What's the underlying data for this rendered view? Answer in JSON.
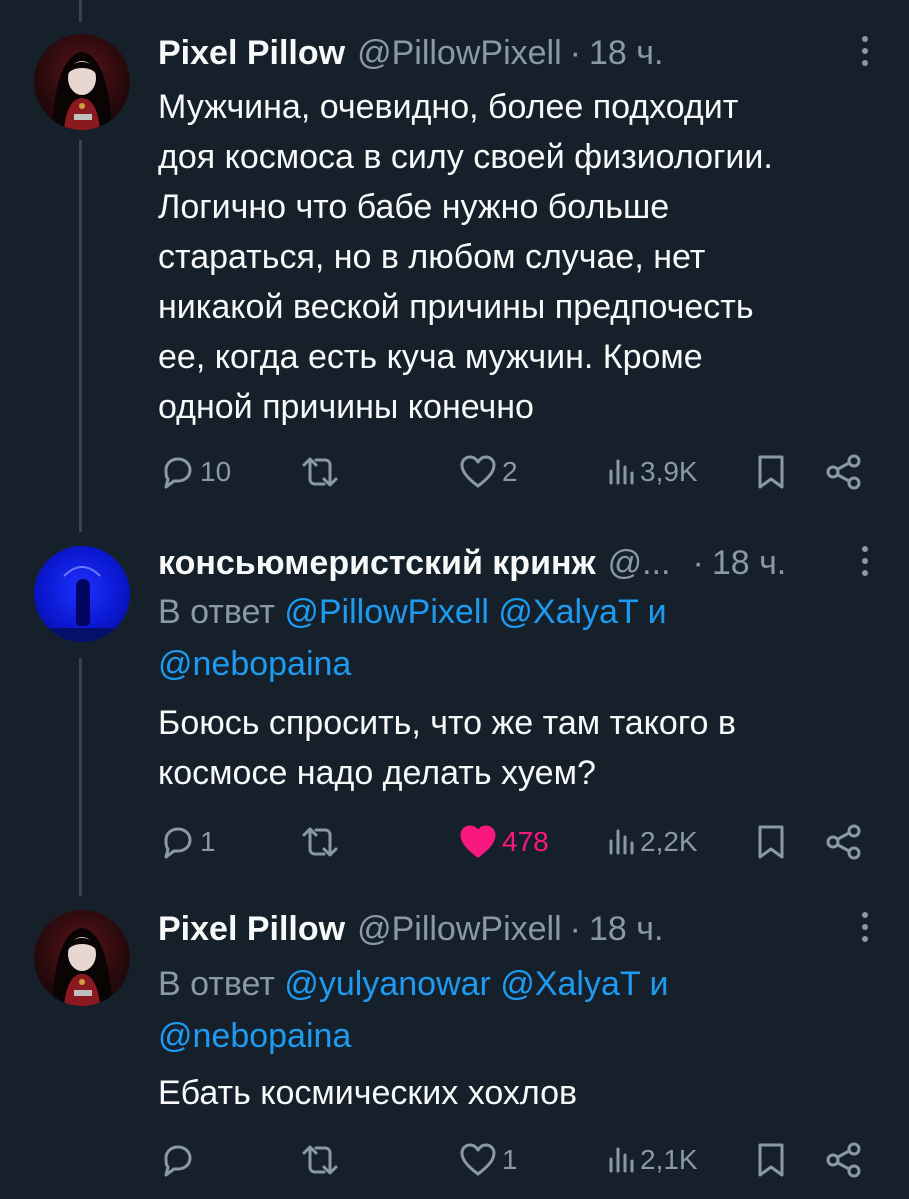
{
  "tweets": [
    {
      "name": "Pixel Pillow",
      "handle": "@PillowPixell",
      "time": "18 ч.",
      "text_lines": [
        "Мужчина, очевидно, более подходит",
        "доя космоса в силу своей физиологии.",
        "Логично что бабе нужно больше",
        "стараться, но в любом случае, нет",
        "никакой веской причины предпочесть",
        "ее, когда есть куча мужчин. Кроме",
        "одной причины конечно"
      ],
      "replies": "10",
      "retweets": "",
      "likes": "2",
      "views": "3,9K",
      "liked": false
    },
    {
      "name": "консьюмеристский кринж",
      "handle": "@...",
      "time": "18 ч.",
      "reply_prefix": "В ответ",
      "reply_mentions_line1": [
        "@PillowPixell",
        "@XalyaT",
        "и"
      ],
      "reply_mentions_line2": "@nebopaina",
      "text_lines": [
        "Боюсь спросить, что же там такого в",
        "космосе надо делать хуем?"
      ],
      "replies": "1",
      "retweets": "",
      "likes": "478",
      "views": "2,2K",
      "liked": true
    },
    {
      "name": "Pixel Pillow",
      "handle": "@PillowPixell",
      "time": "18 ч.",
      "reply_prefix": "В ответ",
      "reply_mentions_line1": [
        "@yulyanowar",
        "@XalyaT",
        "и"
      ],
      "reply_mentions_line2": "@nebopaina",
      "text_lines": [
        "Ебать космических хохлов"
      ],
      "replies": "",
      "retweets": "",
      "likes": "1",
      "views": "2,1K",
      "liked": false
    }
  ],
  "colors": {
    "background": "#15202b",
    "text": "#f7f9f9",
    "muted": "#8b98a5",
    "link": "#1d9bf0",
    "like": "#f91880",
    "thread_line": "#38444d"
  },
  "icons": [
    "reply-icon",
    "retweet-icon",
    "like-icon",
    "views-icon",
    "bookmark-icon",
    "share-icon",
    "more-icon"
  ]
}
